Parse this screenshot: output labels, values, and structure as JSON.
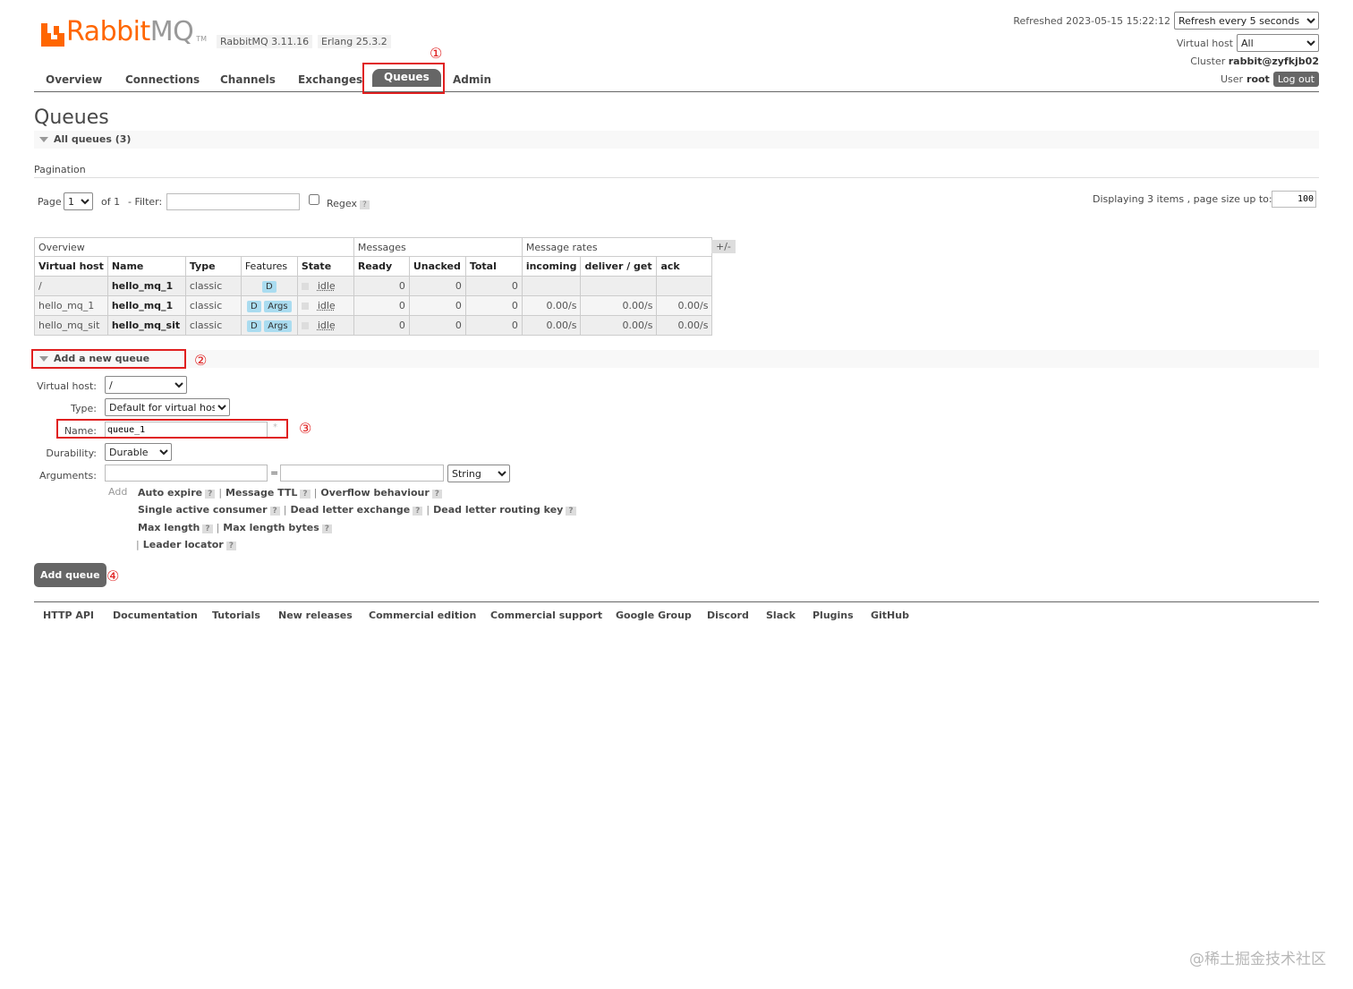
{
  "header": {
    "logo_text_a": "RabbitMQ",
    "logo_text_a1": "Rabbit",
    "logo_text_a2": "MQ",
    "logo_tm": "TM",
    "version": "RabbitMQ 3.11.16",
    "erlang": "Erlang 25.3.2",
    "refreshed": "Refreshed 2023-05-15 15:22:12",
    "refresh_option": "Refresh every 5 seconds",
    "vhost_label": "Virtual host",
    "vhost_value": "All",
    "cluster_label": "Cluster",
    "cluster_value": "rabbit@zyfkjb02",
    "user_label": "User",
    "user_value": "root",
    "logout": "Log out"
  },
  "nav": {
    "tabs": [
      "Overview",
      "Connections",
      "Channels",
      "Exchanges",
      "Queues",
      "Admin"
    ],
    "active": "Queues"
  },
  "annotations": {
    "c1": "①",
    "c2": "②",
    "c3": "③",
    "c4": "④"
  },
  "page": {
    "title": "Queues",
    "all_queues": "All queues (3)",
    "pagination": "Pagination",
    "page_label": "Page",
    "page_value": "1",
    "of_label": "of 1",
    "filter_label": "- Filter:",
    "regex_label": "Regex",
    "help": "?",
    "displaying": "Displaying 3 items , page size up to:",
    "page_size": "100"
  },
  "table": {
    "groups": [
      "Overview",
      "Messages",
      "Message rates"
    ],
    "plus_minus": "+/-",
    "columns": [
      "Virtual host",
      "Name",
      "Type",
      "Features",
      "State",
      "Ready",
      "Unacked",
      "Total",
      "incoming",
      "deliver / get",
      "ack"
    ],
    "rows": [
      {
        "vhost": "/",
        "name": "hello_mq_1",
        "type": "classic",
        "f1": "D",
        "f2": "",
        "state": "idle",
        "ready": "0",
        "unacked": "0",
        "total": "0",
        "incoming": "",
        "deliver": "",
        "ack": ""
      },
      {
        "vhost": "hello_mq_1",
        "name": "hello_mq_1",
        "type": "classic",
        "f1": "D",
        "f2": "Args",
        "state": "idle",
        "ready": "0",
        "unacked": "0",
        "total": "0",
        "incoming": "0.00/s",
        "deliver": "0.00/s",
        "ack": "0.00/s"
      },
      {
        "vhost": "hello_mq_sit",
        "name": "hello_mq_sit",
        "type": "classic",
        "f1": "D",
        "f2": "Args",
        "state": "idle",
        "ready": "0",
        "unacked": "0",
        "total": "0",
        "incoming": "0.00/s",
        "deliver": "0.00/s",
        "ack": "0.00/s"
      }
    ]
  },
  "add_queue": {
    "section": "Add a new queue",
    "vhost_label": "Virtual host:",
    "vhost_value": "/",
    "type_label": "Type:",
    "type_value": "Default for virtual host",
    "name_label": "Name:",
    "name_value": "queue_1",
    "required": "*",
    "durability_label": "Durability:",
    "durability_value": "Durable",
    "arguments_label": "Arguments:",
    "eq": "=",
    "arg_type": "String",
    "add_label": "Add",
    "sep": "|",
    "links": [
      "Auto expire",
      "Message TTL",
      "Overflow behaviour",
      "Single active consumer",
      "Dead letter exchange",
      "Dead letter routing key",
      "Max length",
      "Max length bytes",
      "Leader locator"
    ],
    "button": "Add queue"
  },
  "footer": {
    "links": [
      "HTTP API",
      "Documentation",
      "Tutorials",
      "New releases",
      "Commercial edition",
      "Commercial support",
      "Google Group",
      "Discord",
      "Slack",
      "Plugins",
      "GitHub"
    ]
  },
  "watermark": "@稀土掘金技术社区",
  "colors": {
    "brand_orange": "#ff6600",
    "nav_active": "#666666",
    "annotation_red": "#e02020",
    "feature_badge": "#aadcf0"
  }
}
